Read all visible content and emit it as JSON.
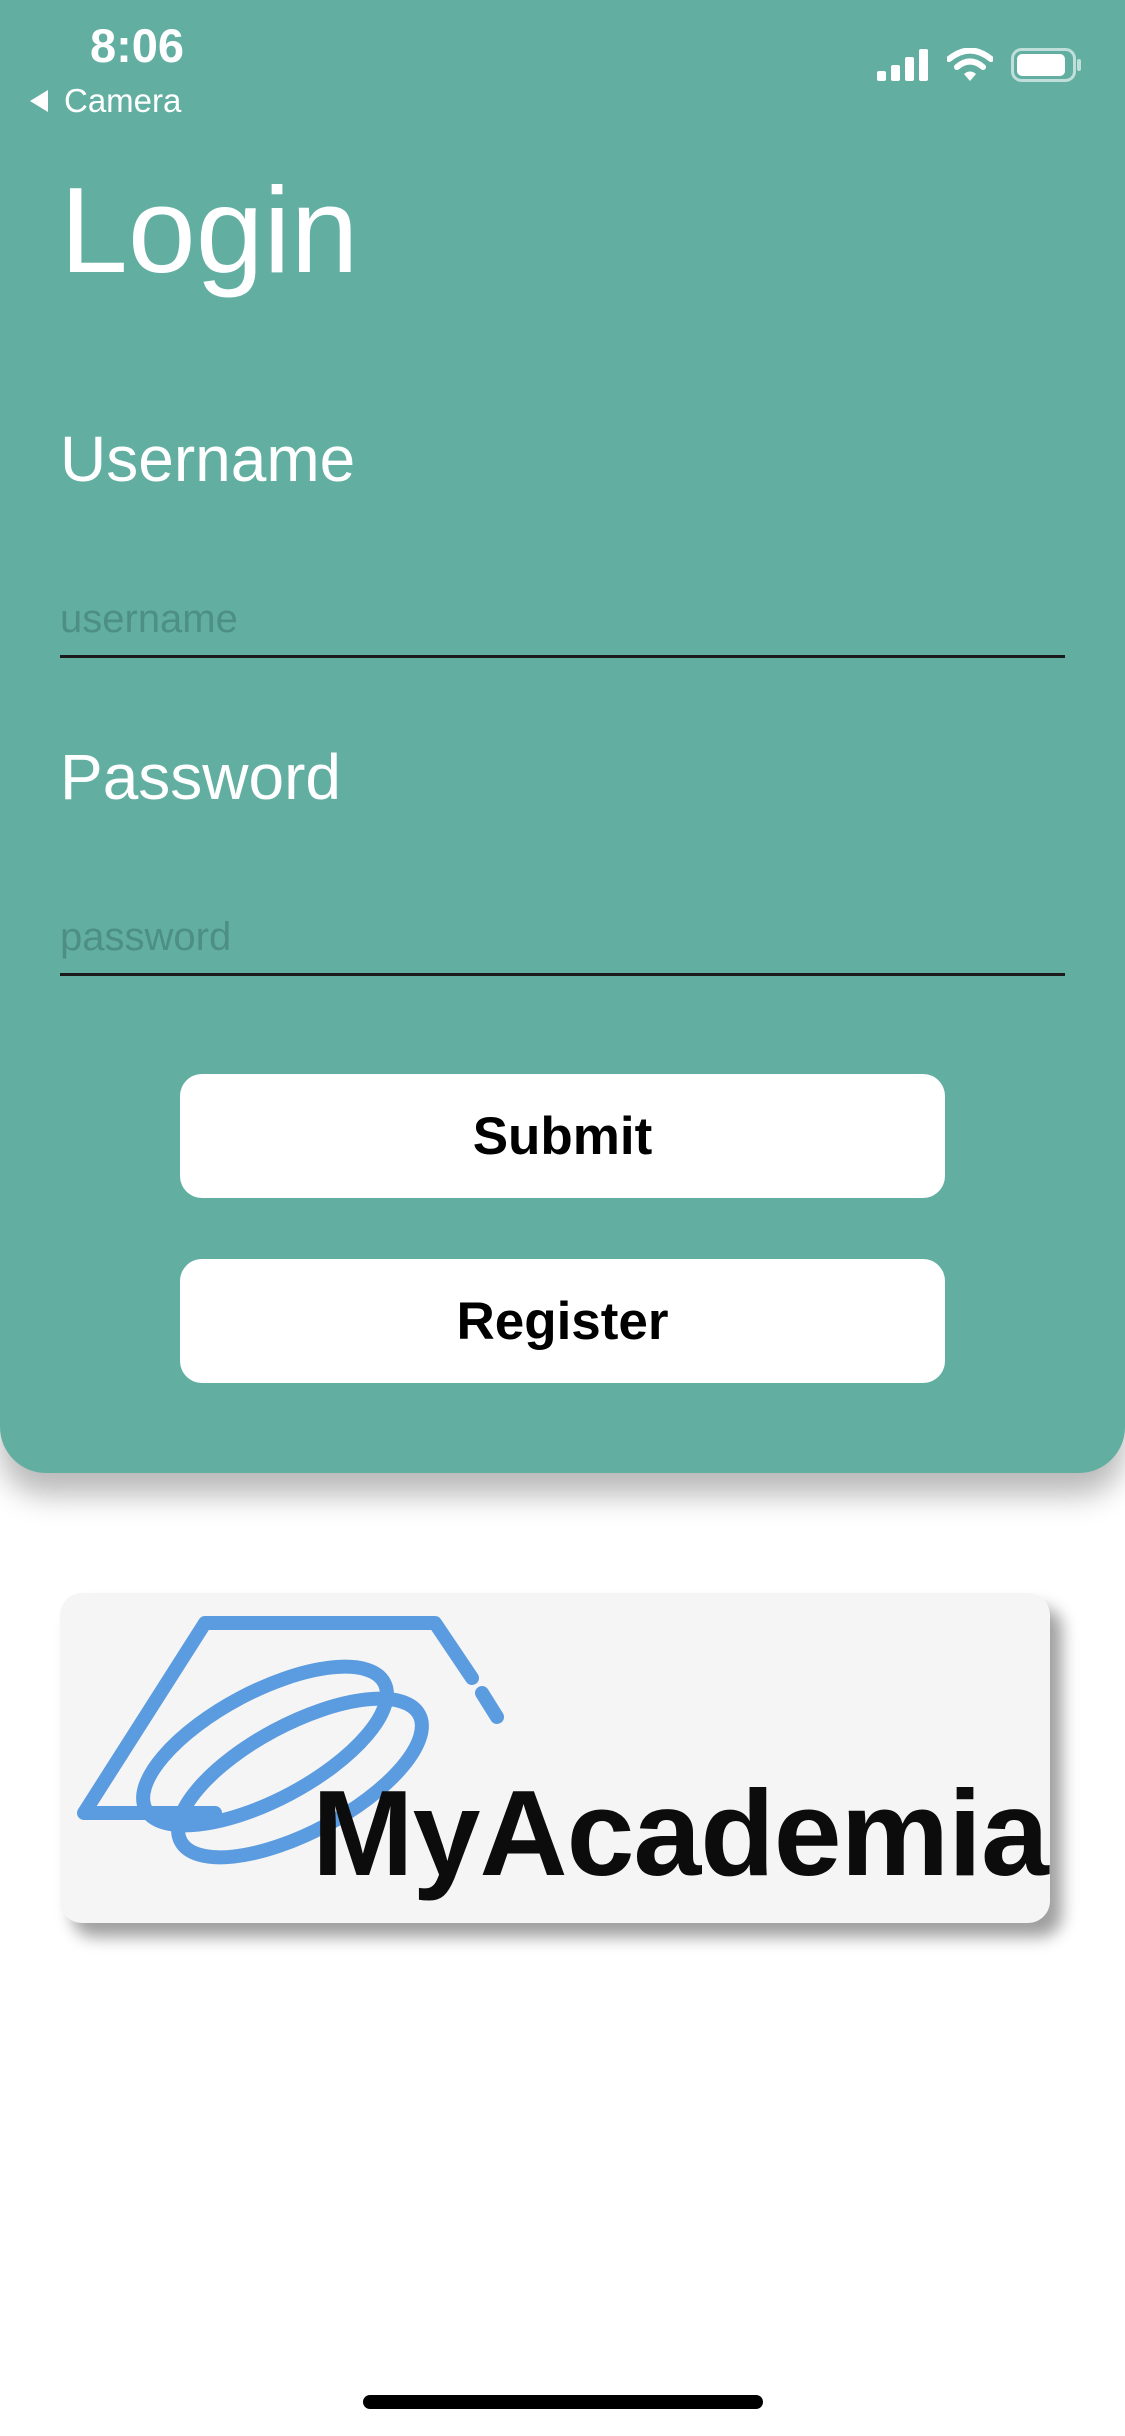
{
  "status_bar": {
    "time": "8:06",
    "back_label": "Camera"
  },
  "login": {
    "title": "Login",
    "username_label": "Username",
    "username_placeholder": "username",
    "password_label": "Password",
    "password_placeholder": "password",
    "submit_label": "Submit",
    "register_label": "Register"
  },
  "logo": {
    "text": "MyAcademia"
  },
  "colors": {
    "panel_background": "#62afa2",
    "logo_blue": "#5b9be0"
  }
}
